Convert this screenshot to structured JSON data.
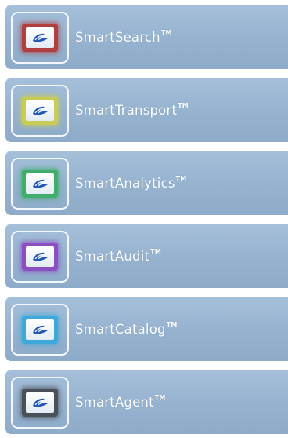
{
  "menu": {
    "items": [
      {
        "label": "SmartSearch",
        "tm": "TM",
        "icon": "logo-icon",
        "accent": "#b04040"
      },
      {
        "label": "SmartTransport",
        "tm": "TM",
        "icon": "logo-icon",
        "accent": "#c8cc55"
      },
      {
        "label": "SmartAnalytics",
        "tm": "TM",
        "icon": "logo-icon",
        "accent": "#3fae6a"
      },
      {
        "label": "SmartAudit",
        "tm": "TM",
        "icon": "logo-icon",
        "accent": "#8a4fc0"
      },
      {
        "label": "SmartCatalog",
        "tm": "TM",
        "icon": "logo-icon",
        "accent": "#3ea8d8"
      },
      {
        "label": "SmartAgent",
        "tm": "TM",
        "icon": "logo-icon",
        "accent": "#4a5058"
      }
    ]
  }
}
